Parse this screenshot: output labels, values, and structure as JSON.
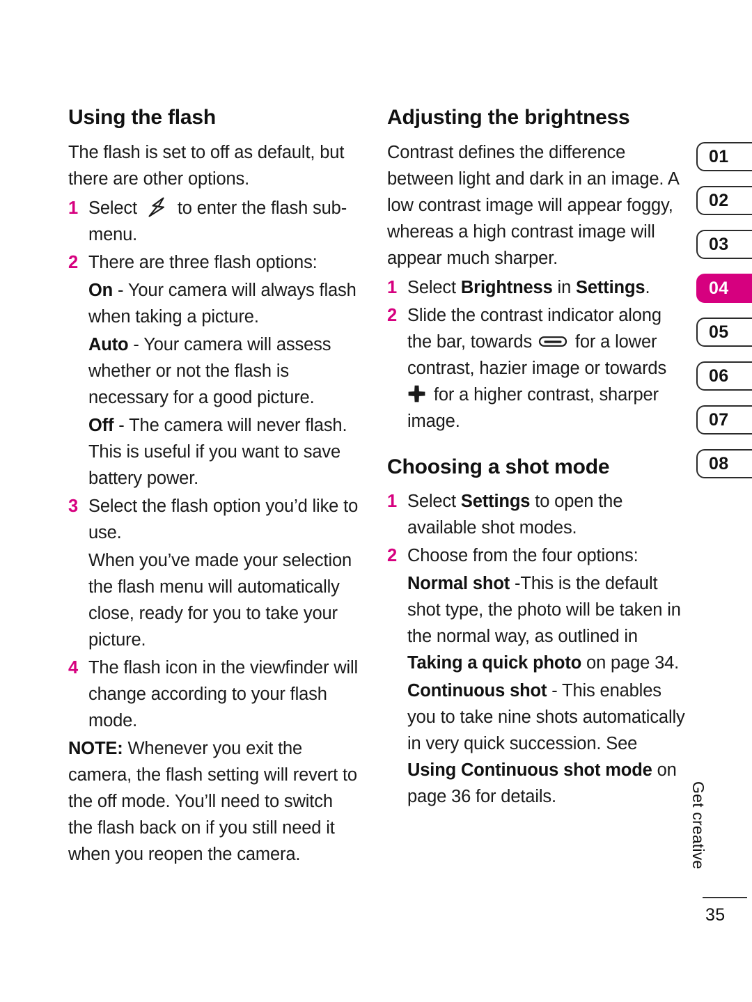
{
  "colors": {
    "accent": "#d6007f",
    "text": "#111111",
    "page_background": "#ffffff"
  },
  "left_column": {
    "heading": "Using the flash",
    "intro": "The flash is set to off as default, but there are other options.",
    "steps": [
      {
        "number": "1",
        "text_before_icon": "Select ",
        "icon": "flash-icon",
        "text_after_icon": " to enter the flash sub-menu."
      },
      {
        "number": "2",
        "text": "There are three flash options:"
      },
      {
        "number": "3",
        "text": "Select the flash option you’d like to use."
      },
      {
        "number": "4",
        "text": "The flash icon in the viewfinder will change according to your flash mode."
      }
    ],
    "flash_options": [
      {
        "label": "On",
        "description": " - Your camera will always flash when taking a picture."
      },
      {
        "label": "Auto",
        "description": " - Your camera will assess whether or not the flash is necessary for a good picture."
      },
      {
        "label": "Off",
        "description": " - The camera will never flash. This is useful if you want to save battery power."
      }
    ],
    "step3_followup": "When you’ve made your selection the flash menu will automatically close, ready for you to take your picture.",
    "note": {
      "label": "NOTE:",
      "text": " Whenever you exit the camera, the flash setting will revert to the off mode. You’ll need to switch the flash back on if you still need it when you reopen the camera."
    }
  },
  "right_column": {
    "brightness": {
      "heading": "Adjusting the brightness",
      "intro": "Contrast defines the difference between light and dark in an image. A low contrast image will appear foggy, whereas a high contrast image will appear much sharper.",
      "step1": {
        "number": "1",
        "prefix": "Select ",
        "bold1": "Brightness",
        "middle": " in ",
        "bold2": "Settings",
        "suffix": "."
      },
      "step2": {
        "number": "2",
        "part1": "Slide the contrast indicator along the bar, towards ",
        "icon_low": "minus-contrast-icon",
        "part2": " for a lower contrast, hazier image or towards ",
        "icon_high": "plus-contrast-icon",
        "part3": " for a higher contrast, sharper image."
      }
    },
    "shot_mode": {
      "heading": "Choosing a shot mode",
      "step1": {
        "number": "1",
        "prefix": "Select ",
        "bold": "Settings",
        "suffix": " to open the available shot modes."
      },
      "step2": {
        "number": "2",
        "text": "Choose from the four options:"
      },
      "options": [
        {
          "label": "Normal shot",
          "part1": " -This is the default shot type, the photo will be taken in the normal way, as outlined in ",
          "bold_ref": "Taking a quick photo",
          "part2": " on page 34."
        },
        {
          "label": "Continuous shot",
          "part1": " - This enables you to take nine shots automatically in very quick succession. See ",
          "bold_ref": "Using Continuous shot mode",
          "part2": " on page 36 for details."
        }
      ]
    }
  },
  "chapter_tabs": {
    "items": [
      {
        "label": "01",
        "active": false
      },
      {
        "label": "02",
        "active": false
      },
      {
        "label": "03",
        "active": false
      },
      {
        "label": "04",
        "active": true
      },
      {
        "label": "05",
        "active": false
      },
      {
        "label": "06",
        "active": false
      },
      {
        "label": "07",
        "active": false
      },
      {
        "label": "08",
        "active": false
      }
    ]
  },
  "footer": {
    "running_head": "Get creative",
    "page_number": "35"
  }
}
